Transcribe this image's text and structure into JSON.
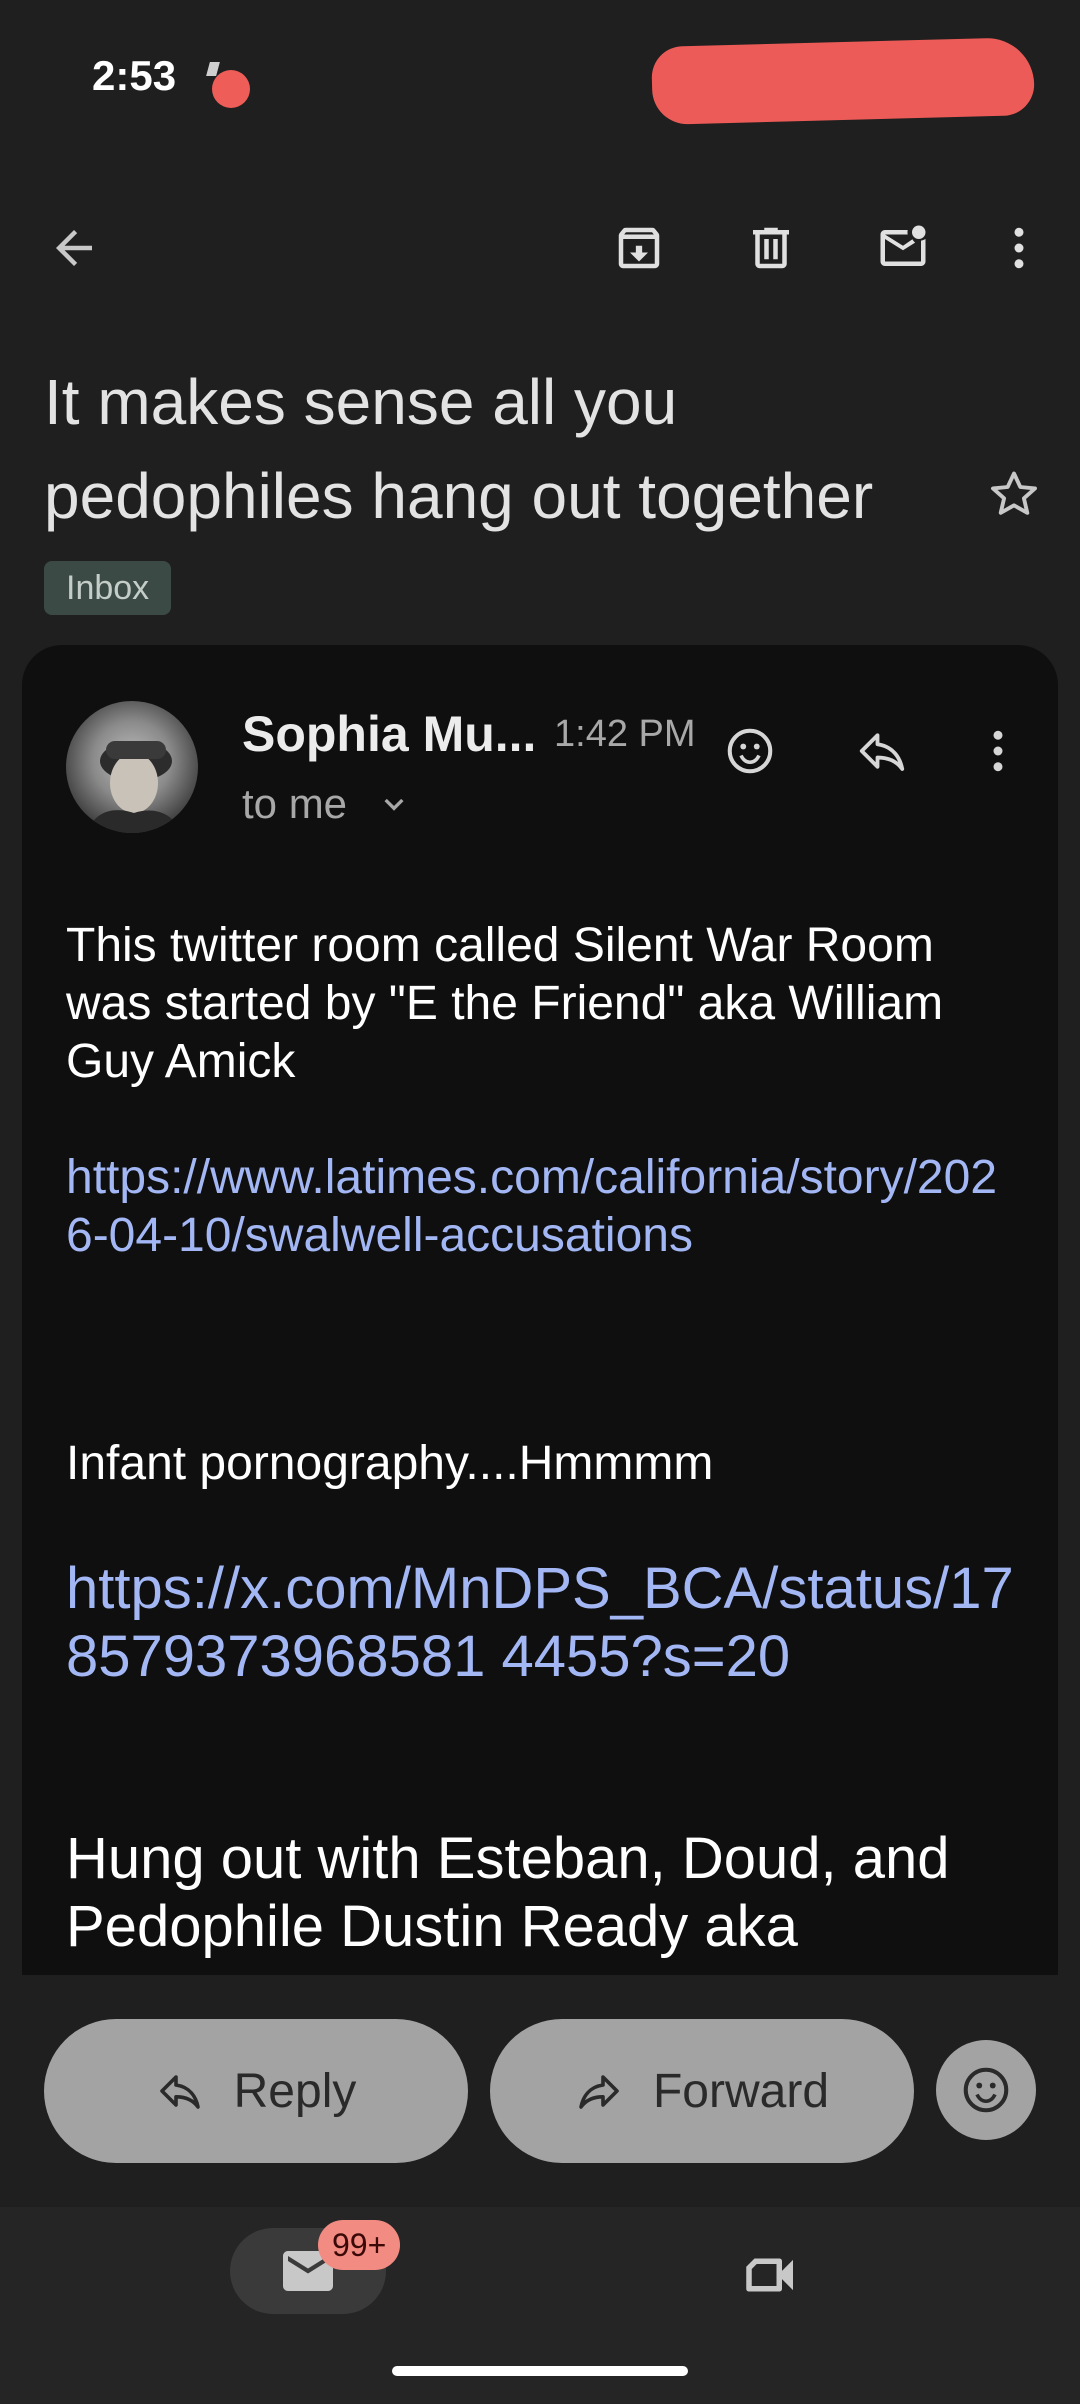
{
  "status_bar": {
    "time": "2:53"
  },
  "toolbar": {
    "back_icon": "arrow-left-icon",
    "archive_icon": "archive-icon",
    "delete_icon": "trash-icon",
    "unread_icon": "mark-unread-icon",
    "more_icon": "more-vert-icon"
  },
  "email": {
    "subject": "It makes sense all you pedophiles hang out together",
    "label": "Inbox",
    "sender": "Sophia Mu...",
    "time": "1:42 PM",
    "recipient": "to me",
    "paragraph1": "This twitter room called Silent War Room was started by \"E the Friend\" aka William Guy Amick",
    "link1": "https://www.latimes.com/california/story/2026-04-10/swalwell-accusations",
    "paragraph2": "Infant pornography....Hmmmm",
    "link2": "https://x.com/MnDPS_BCA/status/178579373968581 4455?s=20",
    "paragraph3": "Hung out with Esteban, Doud, and Pedophile Dustin Ready aka"
  },
  "actions": {
    "reply_label": "Reply",
    "forward_label": "Forward"
  },
  "bottom_nav": {
    "mail_badge": "99+"
  },
  "colors": {
    "background": "#1f1f1f",
    "card": "#0f0f10",
    "link": "#a3b7f5",
    "button": "#a3a3a3",
    "badge": "#f28b82",
    "label_chip": "#3c4a45"
  }
}
